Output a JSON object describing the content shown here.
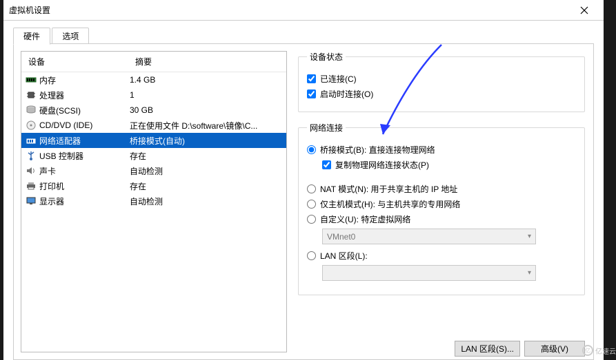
{
  "window": {
    "title": "虚拟机设置"
  },
  "tabs": {
    "hardware": "硬件",
    "options": "选项"
  },
  "columns": {
    "device": "设备",
    "summary": "摘要"
  },
  "devices": [
    {
      "icon": "memory",
      "name": "内存",
      "summary": "1.4 GB"
    },
    {
      "icon": "cpu",
      "name": "处理器",
      "summary": "1"
    },
    {
      "icon": "disk",
      "name": "硬盘(SCSI)",
      "summary": "30 GB"
    },
    {
      "icon": "cd",
      "name": "CD/DVD (IDE)",
      "summary": "正在使用文件 D:\\software\\镜像\\C..."
    },
    {
      "icon": "net",
      "name": "网络适配器",
      "summary": "桥接模式(自动)"
    },
    {
      "icon": "usb",
      "name": "USB 控制器",
      "summary": "存在"
    },
    {
      "icon": "sound",
      "name": "声卡",
      "summary": "自动检测"
    },
    {
      "icon": "printer",
      "name": "打印机",
      "summary": "存在"
    },
    {
      "icon": "monitor",
      "name": "显示器",
      "summary": "自动检测"
    }
  ],
  "status": {
    "legend": "设备状态",
    "connected": "已连接(C)",
    "connectAtPowerOn": "启动时连接(O)"
  },
  "network": {
    "legend": "网络连接",
    "bridged": "桥接模式(B): 直接连接物理网络",
    "replicate": "复制物理网络连接状态(P)",
    "nat": "NAT 模式(N): 用于共享主机的 IP 地址",
    "hostonly": "仅主机模式(H): 与主机共享的专用网络",
    "custom": "自定义(U): 特定虚拟网络",
    "customSelected": "VMnet0",
    "lan": "LAN 区段(L):",
    "lanSelected": ""
  },
  "buttons": {
    "lanSegments": "LAN 区段(S)...",
    "advanced": "高级(V)"
  },
  "watermark": "亿速云"
}
